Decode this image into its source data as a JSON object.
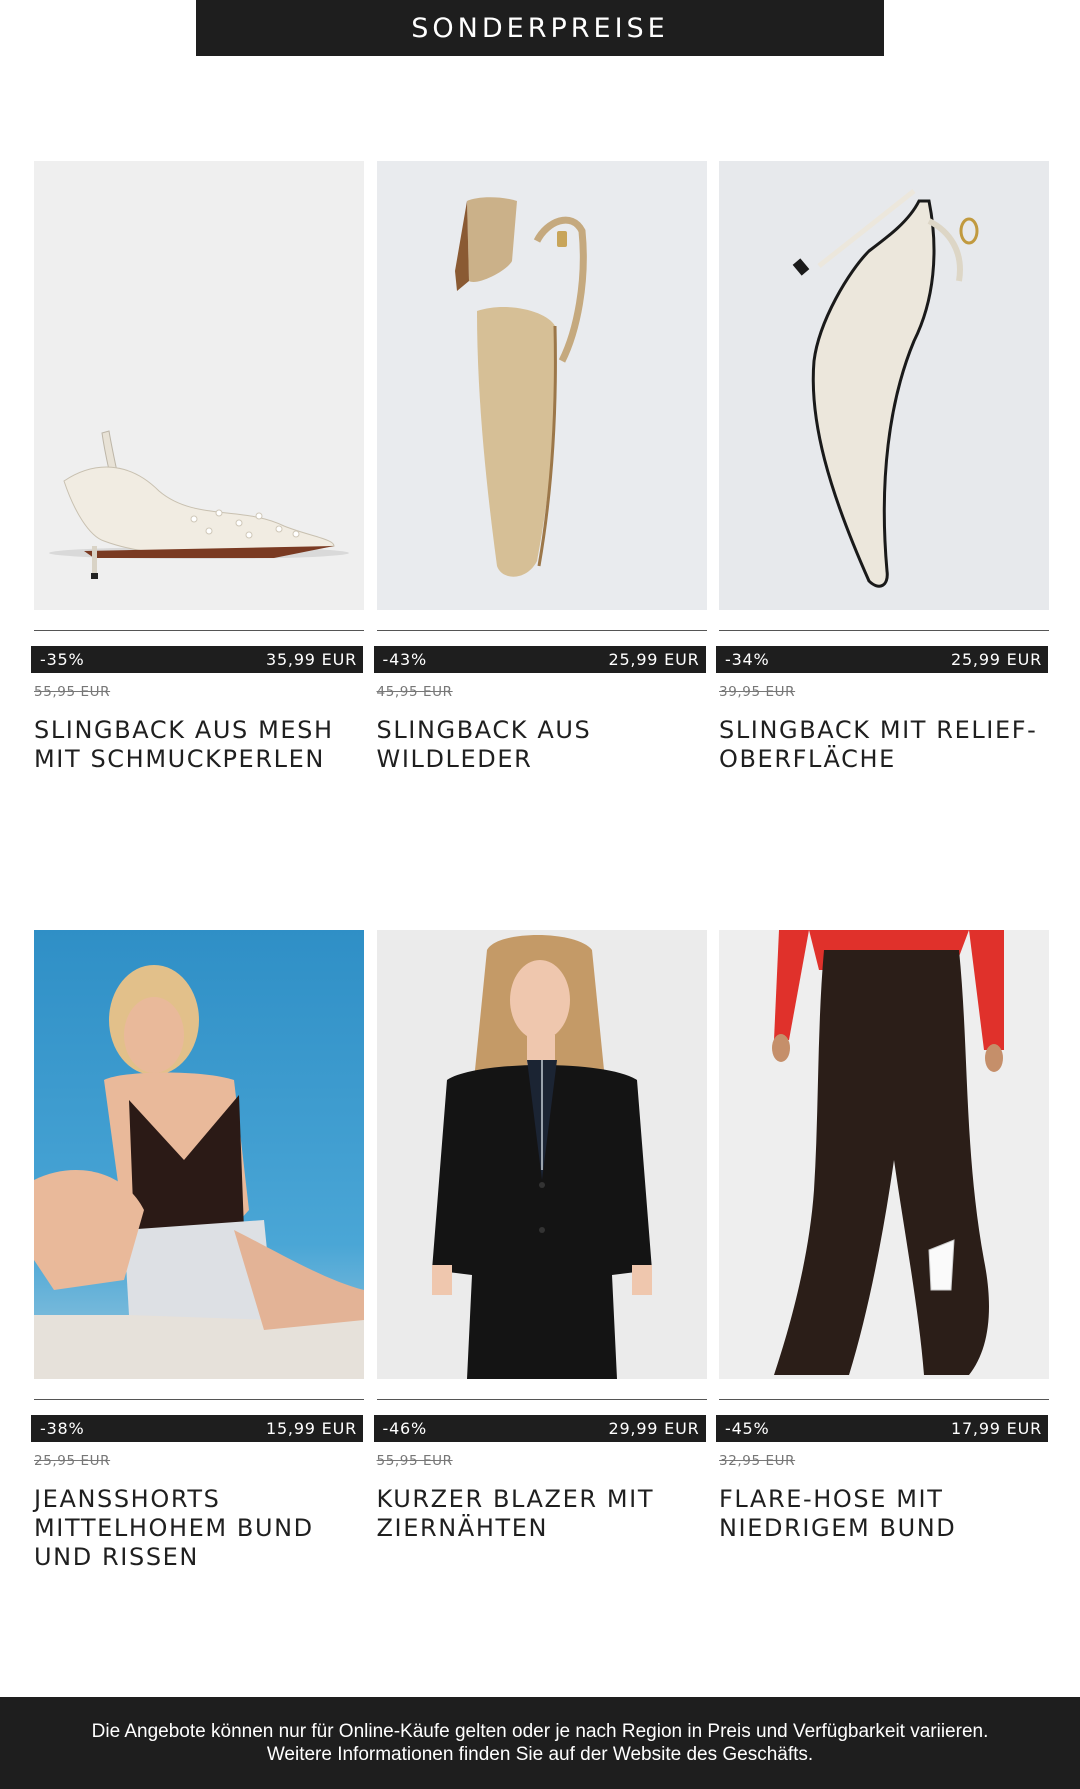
{
  "banner": {
    "title": "SONDERPREISE"
  },
  "products": [
    {
      "discount": "-35%",
      "price": "35,99 EUR",
      "old_price": "55,95 EUR",
      "title": "SLINGBACK AUS MESH\nMIT SCHMUCKPERLEN",
      "image": "pearl-mesh-slingback-photo"
    },
    {
      "discount": "-43%",
      "price": "25,99 EUR",
      "old_price": "45,95 EUR",
      "title": "SLINGBACK AUS\nWILDLEDER",
      "image": "suede-slingback-photo"
    },
    {
      "discount": "-34%",
      "price": "25,99 EUR",
      "old_price": "39,95 EUR",
      "title": "SLINGBACK MIT RELIEF-\nOBERFLÄCHE",
      "image": "embossed-slingback-photo"
    },
    {
      "discount": "-38%",
      "price": "15,99 EUR",
      "old_price": "25,95 EUR",
      "title": "JEANSSHORTS\nMITTELHOHEM BUND\nUND RISSEN",
      "image": "denim-shorts-model-photo"
    },
    {
      "discount": "-46%",
      "price": "29,99 EUR",
      "old_price": "55,95 EUR",
      "title": "KURZER BLAZER MIT\nZIERNÄHTEN",
      "image": "cropped-blazer-model-photo"
    },
    {
      "discount": "-45%",
      "price": "17,99 EUR",
      "old_price": "32,95 EUR",
      "title": "FLARE-HOSE MIT\nNIEDRIGEM BUND",
      "image": "flare-trousers-model-photo"
    }
  ],
  "footer": {
    "line1": "Die Angebote können nur für Online-Käufe gelten oder je nach Region in Preis und Verfügbarkeit variieren.",
    "line2": "Weitere Informationen finden Sie auf der Website des Geschäfts."
  },
  "colors": {
    "bar": "#1e1e1e",
    "text": "#1f1f1f",
    "old_price": "#777777",
    "background": "#ffffff"
  }
}
